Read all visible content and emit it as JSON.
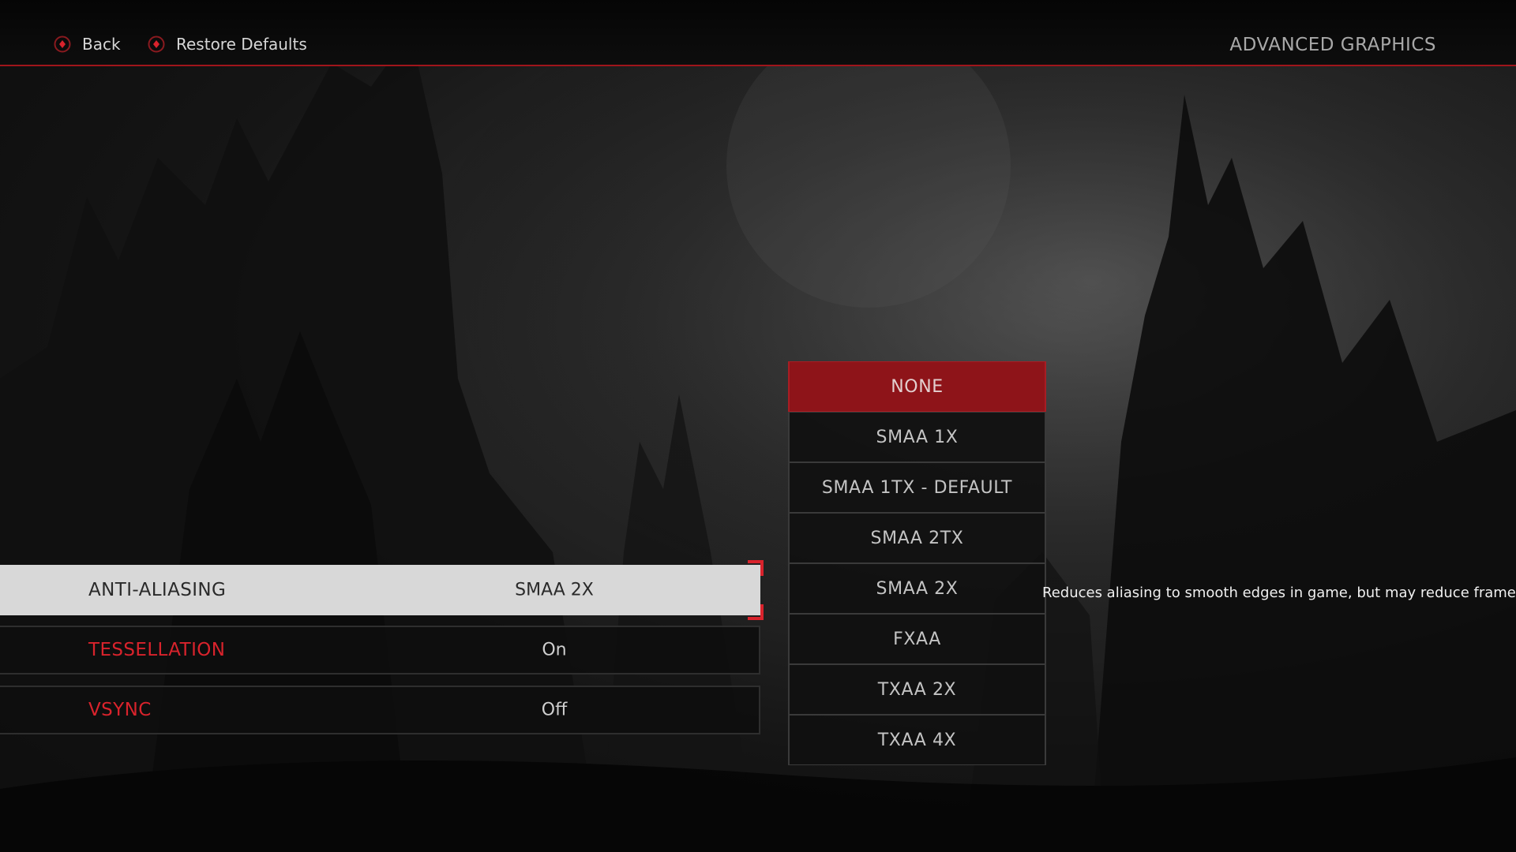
{
  "top_bar": {
    "back_label": "Back",
    "restore_label": "Restore Defaults",
    "back_icon": "controller-button-icon",
    "restore_icon": "controller-button-icon",
    "title": "ADVANCED GRAPHICS"
  },
  "settings": [
    {
      "label": "ANTI-ALIASING",
      "value": "SMAA 2X",
      "focused": true
    },
    {
      "label": "TESSELLATION",
      "value": "On",
      "focused": false
    },
    {
      "label": "VSYNC",
      "value": "Off",
      "focused": false
    }
  ],
  "dropdown": {
    "options": [
      {
        "label": "NONE",
        "selected": true
      },
      {
        "label": "SMAA 1X",
        "selected": false
      },
      {
        "label": "SMAA 1TX - DEFAULT",
        "selected": false
      },
      {
        "label": "SMAA 2TX",
        "selected": false
      },
      {
        "label": "SMAA 2X",
        "selected": false
      },
      {
        "label": "FXAA",
        "selected": false
      },
      {
        "label": "TXAA 2X",
        "selected": false
      },
      {
        "label": "TXAA 4X",
        "selected": false
      }
    ]
  },
  "description": "Reduces aliasing to smooth edges in game, but may reduce frame rate.",
  "colors": {
    "accent": "#d9232c",
    "selected_option": "#8e1419",
    "focused_row": "#d8d8d8"
  }
}
